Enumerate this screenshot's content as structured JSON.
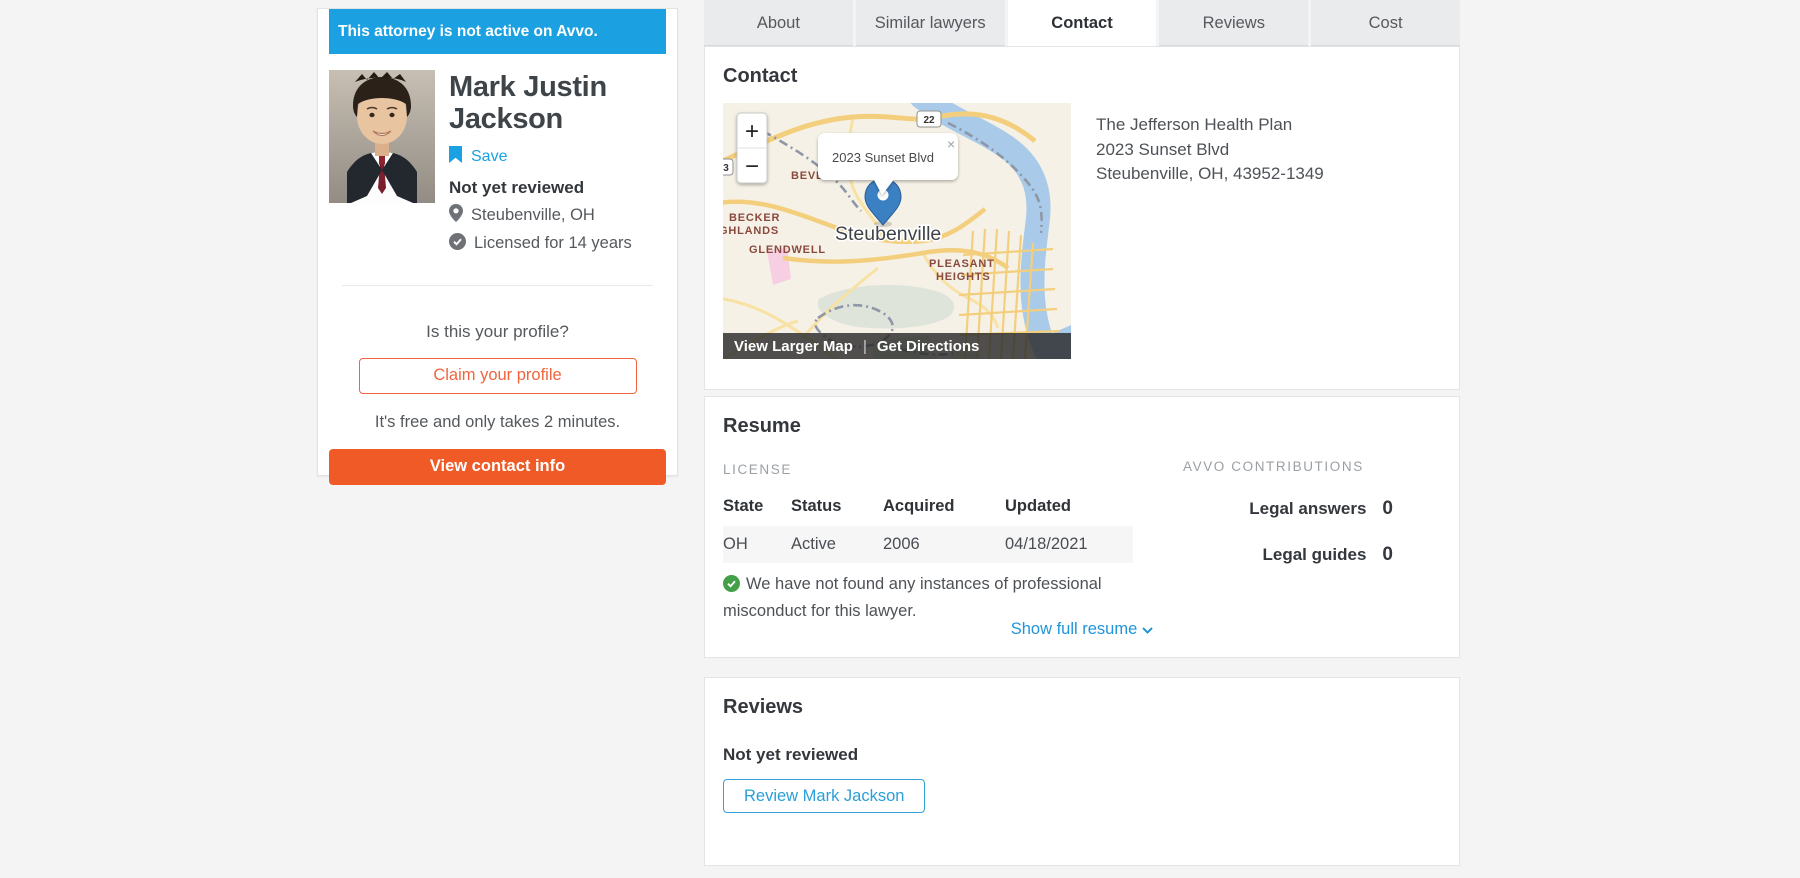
{
  "profile_card": {
    "banner": "This attorney is not active on Avvo.",
    "name": "Mark Justin Jackson",
    "save_label": "Save",
    "review_status": "Not yet reviewed",
    "location": "Steubenville, OH",
    "licensed": "Licensed for 14 years",
    "claim_prompt": "Is this your profile?",
    "claim_button": "Claim your profile",
    "claim_note": "It's free and only takes 2 minutes.",
    "contact_button": "View contact info"
  },
  "tabs": [
    {
      "label": "About"
    },
    {
      "label": "Similar lawyers"
    },
    {
      "label": "Contact"
    },
    {
      "label": "Reviews"
    },
    {
      "label": "Cost"
    }
  ],
  "contact": {
    "heading": "Contact",
    "address_line1": "The Jefferson Health Plan",
    "address_line2": "2023 Sunset Blvd",
    "address_line3": "Steubenville, OH, 43952-1349",
    "map": {
      "zoom_in": "+",
      "zoom_out": "−",
      "popup_label": "2023 Sunset Blvd",
      "close": "×",
      "route_shield": "22",
      "route_shield_left": "3",
      "label_beverly": "BEVERLY HILLS",
      "label_becker_1": "BECKER",
      "label_becker_2": "GHLANDS",
      "label_glendwell": "GLENDWELL",
      "label_city": "Steubenville",
      "label_pleasant_1": "PLEASANT",
      "label_pleasant_2": "HEIGHTS",
      "view_larger": "View Larger Map",
      "separator": "|",
      "get_directions": "Get Directions"
    }
  },
  "resume": {
    "heading": "Resume",
    "license_label": "LICENSE",
    "table": {
      "headers": [
        "State",
        "Status",
        "Acquired",
        "Updated"
      ],
      "rows": [
        [
          "OH",
          "Active",
          "2006",
          "04/18/2021"
        ]
      ]
    },
    "misconduct_note": "We have not found any instances of professional misconduct for this lawyer.",
    "show_full_label": "Show full resume",
    "contributions_heading": "AVVO CONTRIBUTIONS",
    "contributions": [
      {
        "label": "Legal answers",
        "value": "0"
      },
      {
        "label": "Legal guides",
        "value": "0"
      }
    ]
  },
  "reviews": {
    "heading": "Reviews",
    "status": "Not yet reviewed",
    "review_button": "Review Mark Jackson"
  },
  "colors": {
    "avvo_blue": "#1ba1e2",
    "link_blue": "#2095d9",
    "orange": "#f05a26",
    "dark_text": "#3b4045",
    "gray_text": "#55595e",
    "muted_text": "#9ba0a5",
    "green_check": "#43a047"
  }
}
